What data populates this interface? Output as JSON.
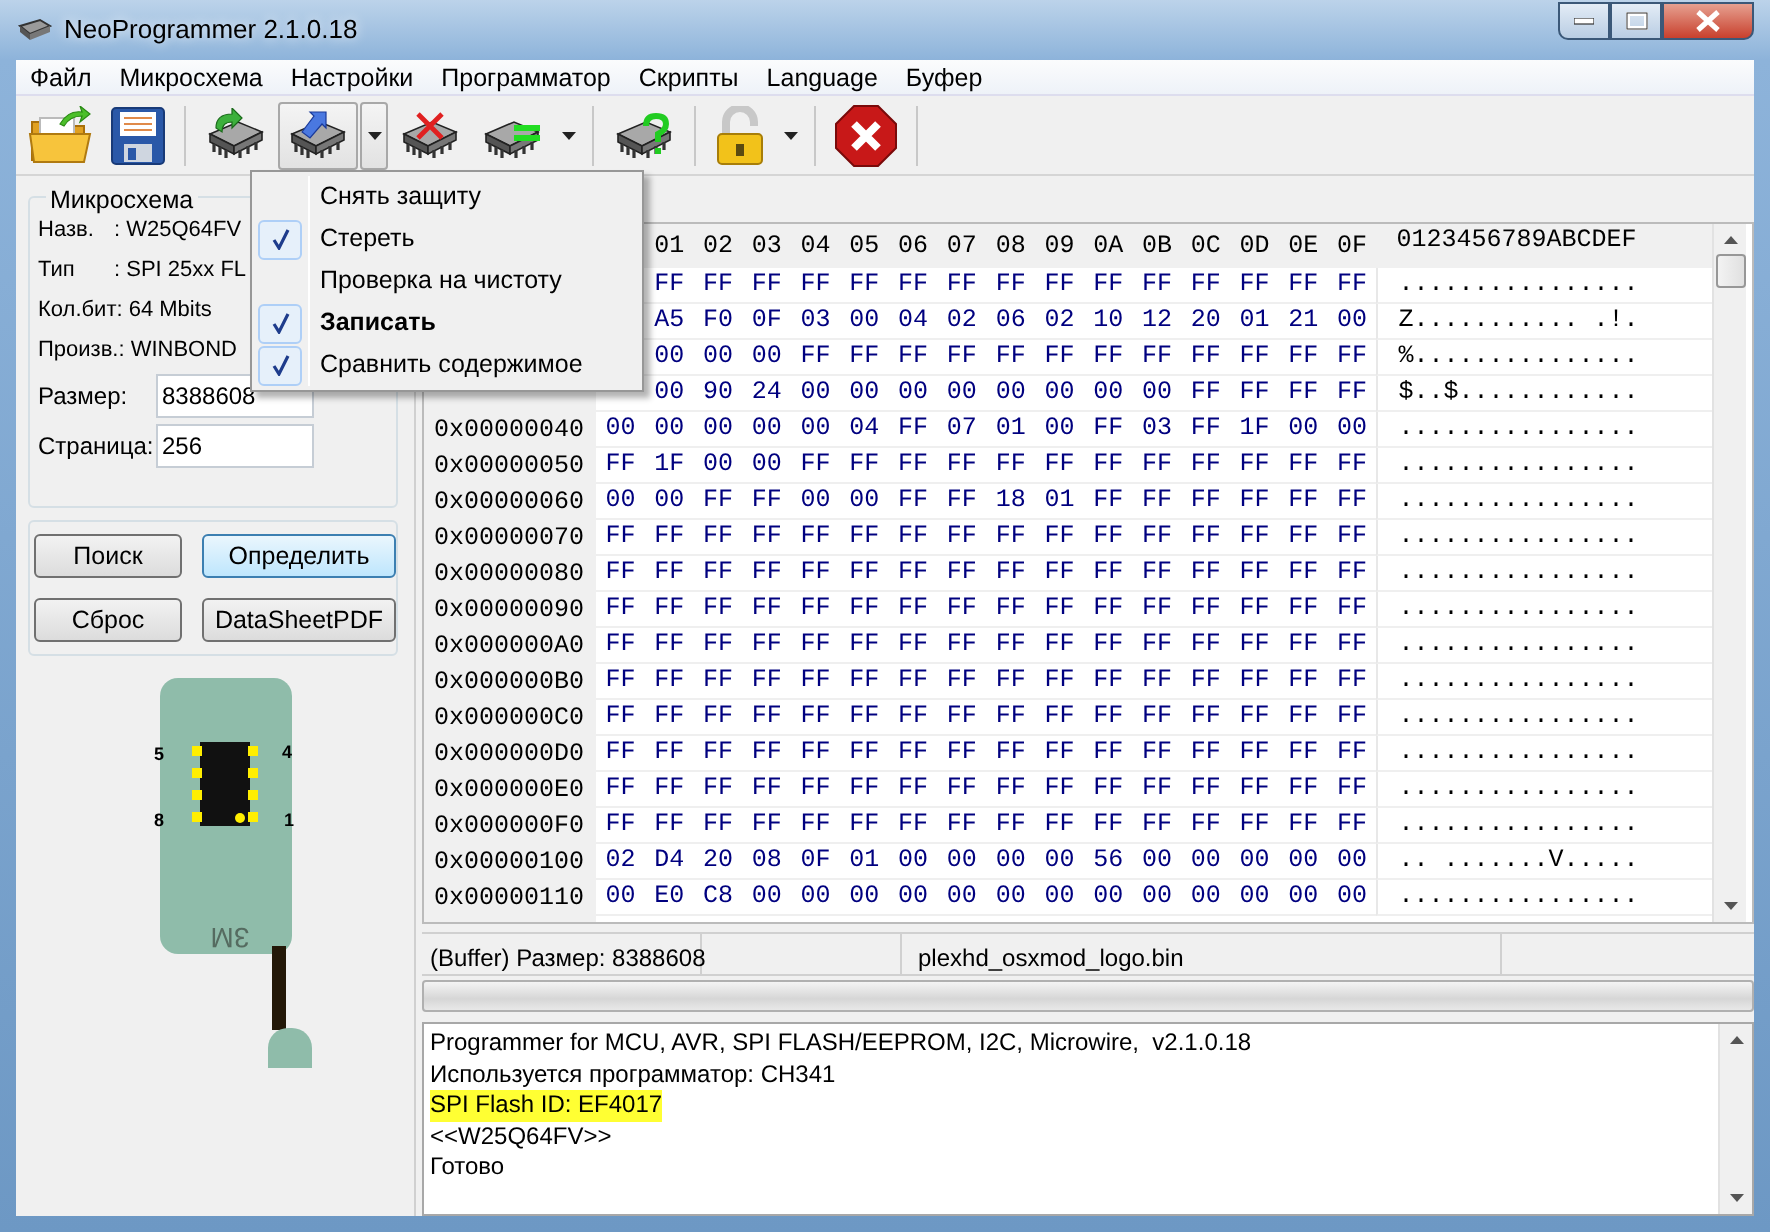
{
  "window": {
    "title": "NeoProgrammer 2.1.0.18"
  },
  "menu": [
    "Файл",
    "Микросхема",
    "Настройки",
    "Программатор",
    "Скрипты",
    "Language",
    "Буфер"
  ],
  "toolbar": [
    {
      "kind": "open",
      "pressed": false
    },
    {
      "kind": "save",
      "pressed": false
    },
    {
      "kind": "separator"
    },
    {
      "kind": "read",
      "pressed": false
    },
    {
      "kind": "write",
      "pressed": true
    },
    {
      "kind": "dropdown",
      "pressed": true
    },
    {
      "kind": "erase",
      "pressed": false
    },
    {
      "kind": "verify",
      "pressed": false
    },
    {
      "kind": "dropdown",
      "pressed": false
    },
    {
      "kind": "separator"
    },
    {
      "kind": "detect",
      "pressed": false
    },
    {
      "kind": "separator"
    },
    {
      "kind": "lock",
      "pressed": false
    },
    {
      "kind": "dropdown",
      "pressed": false
    },
    {
      "kind": "separator"
    },
    {
      "kind": "stop",
      "pressed": false
    },
    {
      "kind": "separator"
    }
  ],
  "dropdown_menu": [
    {
      "label": "Снять защиту",
      "checked": false,
      "default": false
    },
    {
      "label": "Стереть",
      "checked": true,
      "default": false
    },
    {
      "label": "Проверка на чистоту",
      "checked": false,
      "default": false
    },
    {
      "label": "Записать",
      "checked": true,
      "default": true
    },
    {
      "label": "Сравнить содержимое",
      "checked": true,
      "default": false
    }
  ],
  "chip": {
    "title": "Микросхема",
    "fields": [
      {
        "label": "Назв.",
        "colon": ":",
        "value": "W25Q64FV"
      },
      {
        "label": "Тип",
        "colon": ":",
        "value": "SPI 25xx FL"
      },
      {
        "label": "Кол.бит:",
        "value": "64 Mbits"
      },
      {
        "label": "Произв.:",
        "value": "WINBOND"
      }
    ],
    "inputs": [
      {
        "label": "Размер:",
        "value": "8388608"
      },
      {
        "label": "Страница:",
        "value": "256"
      }
    ]
  },
  "buttons": [
    {
      "label": "Поиск",
      "focused": false
    },
    {
      "label": "Определить",
      "focused": true
    },
    {
      "label": "Сброс",
      "focused": false
    },
    {
      "label": "DataSheetPDF",
      "focused": false
    }
  ],
  "socket": {
    "pin_labels": [
      "5",
      "4",
      "8",
      "1"
    ],
    "maker": "3M"
  },
  "hex": {
    "columns": [
      "01",
      "02",
      "03",
      "04",
      "05",
      "06",
      "07",
      "08",
      "09",
      "0A",
      "0B",
      "0C",
      "0D",
      "0E",
      "0F"
    ],
    "ascii_header": "0123456789ABCDEF",
    "rows": [
      {
        "bytes": [
          "FF",
          "FF",
          "FF",
          "FF",
          "FF",
          "FF",
          "FF",
          "FF",
          "FF",
          "FF",
          "FF",
          "FF",
          "FF",
          "FF",
          "FF"
        ],
        "ascii": "................"
      },
      {
        "bytes": [
          "A5",
          "F0",
          "0F",
          "03",
          "00",
          "04",
          "02",
          "06",
          "02",
          "10",
          "12",
          "20",
          "01",
          "21",
          "00"
        ],
        "ascii": "Z........... .!."
      },
      {
        "bytes": [
          "00",
          "00",
          "00",
          "FF",
          "FF",
          "FF",
          "FF",
          "FF",
          "FF",
          "FF",
          "FF",
          "FF",
          "FF",
          "FF",
          "FF"
        ],
        "ascii": "%..............."
      },
      {
        "bytes": [
          "00",
          "90",
          "24",
          "00",
          "00",
          "00",
          "00",
          "00",
          "00",
          "00",
          "00",
          "FF",
          "FF",
          "FF",
          "FF"
        ],
        "ascii": "$..$............"
      },
      {
        "address": "0x00000040",
        "bytes": [
          "00",
          "00",
          "00",
          "00",
          "00",
          "04",
          "FF",
          "07",
          "01",
          "00",
          "FF",
          "03",
          "FF",
          "1F",
          "00",
          "00"
        ],
        "ascii": "................"
      },
      {
        "address": "0x00000050",
        "bytes": [
          "FF",
          "1F",
          "00",
          "00",
          "FF",
          "FF",
          "FF",
          "FF",
          "FF",
          "FF",
          "FF",
          "FF",
          "FF",
          "FF",
          "FF",
          "FF"
        ],
        "ascii": "................"
      },
      {
        "address": "0x00000060",
        "bytes": [
          "00",
          "00",
          "FF",
          "FF",
          "00",
          "00",
          "FF",
          "FF",
          "18",
          "01",
          "FF",
          "FF",
          "FF",
          "FF",
          "FF",
          "FF"
        ],
        "ascii": "................"
      },
      {
        "address": "0x00000070",
        "bytes": [
          "FF",
          "FF",
          "FF",
          "FF",
          "FF",
          "FF",
          "FF",
          "FF",
          "FF",
          "FF",
          "FF",
          "FF",
          "FF",
          "FF",
          "FF",
          "FF"
        ],
        "ascii": "................"
      },
      {
        "address": "0x00000080",
        "bytes": [
          "FF",
          "FF",
          "FF",
          "FF",
          "FF",
          "FF",
          "FF",
          "FF",
          "FF",
          "FF",
          "FF",
          "FF",
          "FF",
          "FF",
          "FF",
          "FF"
        ],
        "ascii": "................"
      },
      {
        "address": "0x00000090",
        "bytes": [
          "FF",
          "FF",
          "FF",
          "FF",
          "FF",
          "FF",
          "FF",
          "FF",
          "FF",
          "FF",
          "FF",
          "FF",
          "FF",
          "FF",
          "FF",
          "FF"
        ],
        "ascii": "................"
      },
      {
        "address": "0x000000A0",
        "bytes": [
          "FF",
          "FF",
          "FF",
          "FF",
          "FF",
          "FF",
          "FF",
          "FF",
          "FF",
          "FF",
          "FF",
          "FF",
          "FF",
          "FF",
          "FF",
          "FF"
        ],
        "ascii": "................"
      },
      {
        "address": "0x000000B0",
        "bytes": [
          "FF",
          "FF",
          "FF",
          "FF",
          "FF",
          "FF",
          "FF",
          "FF",
          "FF",
          "FF",
          "FF",
          "FF",
          "FF",
          "FF",
          "FF",
          "FF"
        ],
        "ascii": "................"
      },
      {
        "address": "0x000000C0",
        "bytes": [
          "FF",
          "FF",
          "FF",
          "FF",
          "FF",
          "FF",
          "FF",
          "FF",
          "FF",
          "FF",
          "FF",
          "FF",
          "FF",
          "FF",
          "FF",
          "FF"
        ],
        "ascii": "................"
      },
      {
        "address": "0x000000D0",
        "bytes": [
          "FF",
          "FF",
          "FF",
          "FF",
          "FF",
          "FF",
          "FF",
          "FF",
          "FF",
          "FF",
          "FF",
          "FF",
          "FF",
          "FF",
          "FF",
          "FF"
        ],
        "ascii": "................"
      },
      {
        "address": "0x000000E0",
        "bytes": [
          "FF",
          "FF",
          "FF",
          "FF",
          "FF",
          "FF",
          "FF",
          "FF",
          "FF",
          "FF",
          "FF",
          "FF",
          "FF",
          "FF",
          "FF",
          "FF"
        ],
        "ascii": "................"
      },
      {
        "address": "0x000000F0",
        "bytes": [
          "FF",
          "FF",
          "FF",
          "FF",
          "FF",
          "FF",
          "FF",
          "FF",
          "FF",
          "FF",
          "FF",
          "FF",
          "FF",
          "FF",
          "FF",
          "FF"
        ],
        "ascii": "................"
      },
      {
        "address": "0x00000100",
        "bytes": [
          "02",
          "D4",
          "20",
          "08",
          "0F",
          "01",
          "00",
          "00",
          "00",
          "00",
          "56",
          "00",
          "00",
          "00",
          "00",
          "00"
        ],
        "ascii": ".. .......V....."
      },
      {
        "address": "0x00000110",
        "bytes": [
          "00",
          "E0",
          "C8",
          "00",
          "00",
          "00",
          "00",
          "00",
          "00",
          "00",
          "00",
          "00",
          "00",
          "00",
          "00",
          "00"
        ],
        "ascii": "................"
      }
    ]
  },
  "status_bar": {
    "size": "(Buffer) Размер: 8388608",
    "file": "plexhd_osxmod_logo.bin"
  },
  "progress": {
    "level": 0
  },
  "log": [
    {
      "text": "Programmer for MCU, AVR, SPI FLASH/EEPROM, I2C, Microwire,  v2.1.0.18",
      "highlighted": false
    },
    {
      "text": "Используется программатор: CH341",
      "highlighted": false
    },
    {
      "text": "SPI Flash ID: EF4017",
      "highlighted": true
    },
    {
      "text": "<<W25Q64FV>>",
      "highlighted": false
    },
    {
      "text": "Готово",
      "highlighted": false
    }
  ]
}
